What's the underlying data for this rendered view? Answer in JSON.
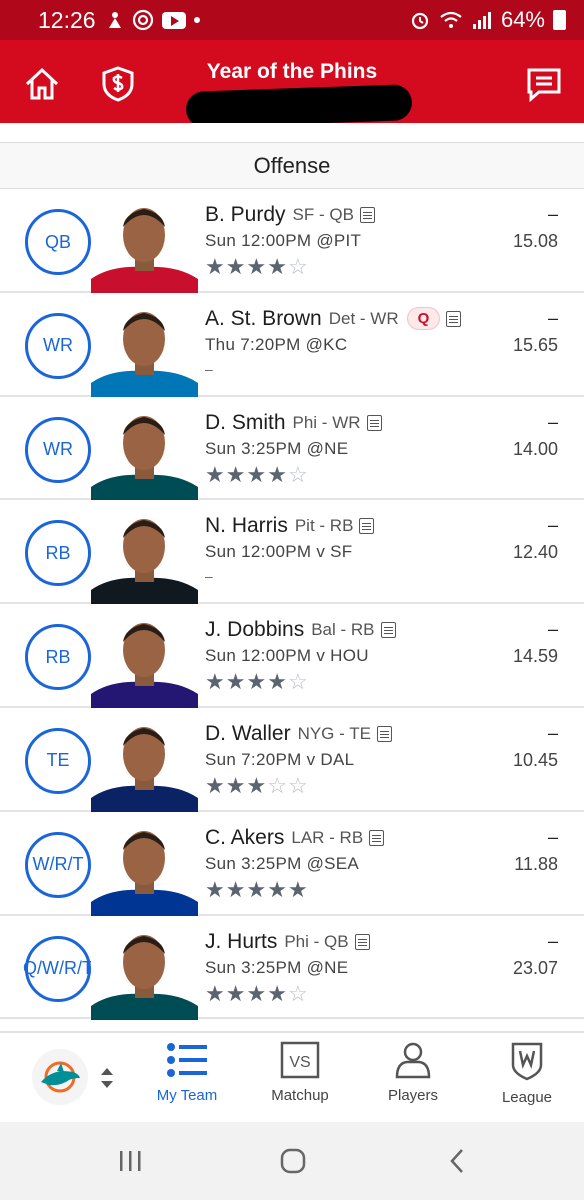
{
  "status_bar": {
    "time": "12:26",
    "battery": "64%",
    "icons": [
      "notification-icon",
      "at-icon",
      "youtube-icon",
      "dot-icon",
      "alarm-icon",
      "wifi-icon",
      "signal-icon",
      "battery-icon"
    ]
  },
  "app_bar": {
    "title": "Year of the Phins",
    "left_icons": [
      "home-icon",
      "money-shield-icon"
    ],
    "right_icon": "chat-icon",
    "color": "#d40a1f"
  },
  "section": {
    "title": "Offense"
  },
  "roster": [
    {
      "pos": "QB",
      "name": "B. Purdy",
      "team": "SF - QB",
      "game": "Sun 12:00PM @PIT",
      "stars": 4,
      "proj": "15.08",
      "actual": "–",
      "status": ""
    },
    {
      "pos": "WR",
      "name": "A. St. Brown",
      "team": "Det - WR",
      "game": "Thu 7:20PM @KC",
      "stars": 0,
      "proj": "15.65",
      "actual": "–",
      "status": "Q"
    },
    {
      "pos": "WR",
      "name": "D. Smith",
      "team": "Phi - WR",
      "game": "Sun 3:25PM @NE",
      "stars": 4,
      "proj": "14.00",
      "actual": "–",
      "status": ""
    },
    {
      "pos": "RB",
      "name": "N. Harris",
      "team": "Pit - RB",
      "game": "Sun 12:00PM v SF",
      "stars": 0,
      "proj": "12.40",
      "actual": "–",
      "status": ""
    },
    {
      "pos": "RB",
      "name": "J. Dobbins",
      "team": "Bal - RB",
      "game": "Sun 12:00PM v HOU",
      "stars": 4,
      "proj": "14.59",
      "actual": "–",
      "status": ""
    },
    {
      "pos": "TE",
      "name": "D. Waller",
      "team": "NYG - TE",
      "game": "Sun 7:20PM v DAL",
      "stars": 3,
      "proj": "10.45",
      "actual": "–",
      "status": ""
    },
    {
      "pos": "W/R/T",
      "name": "C. Akers",
      "team": "LAR - RB",
      "game": "Sun 3:25PM @SEA",
      "stars": 5,
      "proj": "11.88",
      "actual": "–",
      "status": ""
    },
    {
      "pos": "Q/W/R/T",
      "name": "J. Hurts",
      "team": "Phi - QB",
      "game": "Sun 3:25PM @NE",
      "stars": 4,
      "proj": "23.07",
      "actual": "–",
      "status": ""
    }
  ],
  "jersey_colors": [
    "#c8102e",
    "#0076b6",
    "#004c54",
    "#101820",
    "#241773",
    "#0b2265",
    "#003594",
    "#004c54"
  ],
  "no_rating_text": "–",
  "bottom_nav": {
    "items": [
      {
        "label": "My Team",
        "icon": "list-icon",
        "active": true
      },
      {
        "label": "Matchup",
        "icon": "vs-icon",
        "active": false
      },
      {
        "label": "Players",
        "icon": "person-icon",
        "active": false
      },
      {
        "label": "League",
        "icon": "league-shield-icon",
        "active": false
      }
    ],
    "team_logo": "dolphin-logo-icon",
    "accent": "#1a66d9"
  },
  "system_nav": [
    "recent-apps-icon",
    "home-circle-icon",
    "back-icon"
  ]
}
